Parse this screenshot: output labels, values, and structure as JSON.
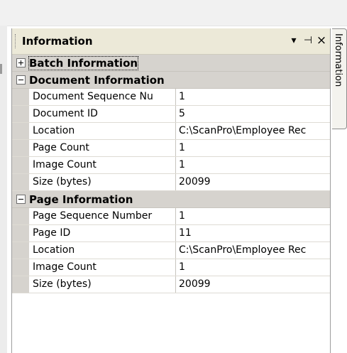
{
  "panel": {
    "title": "Information",
    "buttons": {
      "dropdown": "▾",
      "pin": "⊣",
      "close": "×"
    }
  },
  "side_tab": {
    "label": "Information"
  },
  "categories": [
    {
      "label": "Batch Information",
      "expanded": false,
      "rows": []
    },
    {
      "label": "Document Information",
      "expanded": true,
      "rows": [
        {
          "name": "Document Sequence Nu",
          "value": "1"
        },
        {
          "name": "Document ID",
          "value": "5"
        },
        {
          "name": "Location",
          "value": "C:\\ScanPro\\Employee Rec"
        },
        {
          "name": "Page Count",
          "value": "1"
        },
        {
          "name": "Image Count",
          "value": "1"
        },
        {
          "name": "Size (bytes)",
          "value": "20099"
        }
      ]
    },
    {
      "label": "Page Information",
      "expanded": true,
      "rows": [
        {
          "name": "Page Sequence Number",
          "value": "1"
        },
        {
          "name": "Page ID",
          "value": "11"
        },
        {
          "name": "Location",
          "value": "C:\\ScanPro\\Employee Rec"
        },
        {
          "name": "Image Count",
          "value": "1"
        },
        {
          "name": "Size (bytes)",
          "value": "20099"
        }
      ]
    }
  ]
}
